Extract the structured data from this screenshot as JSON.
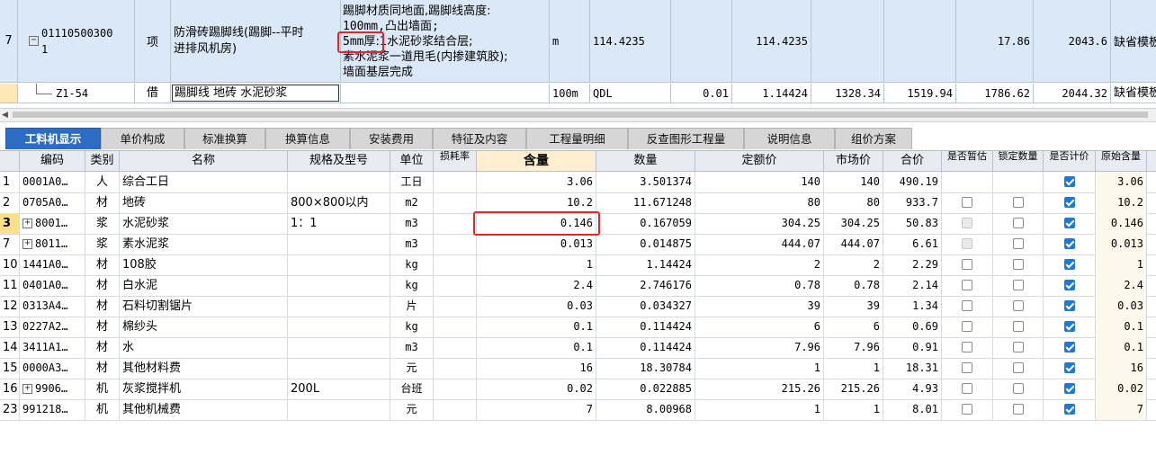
{
  "top": {
    "row1": {
      "index": "7",
      "toggle": "−",
      "code_l1": "01110500300",
      "code_l2": "1",
      "type": "项",
      "name_l1": "防滑砖踢脚线(踢脚--平时",
      "name_l2": "进排风机房)",
      "desc_l1": "踢脚材质同地面,踢脚线高度:",
      "desc_l2": "100mm,凸出墙面;",
      "desc_l3a": "5mm厚",
      "desc_l3b": ":1水泥砂浆结合层;",
      "desc_l4": "素水泥浆一道甩毛(内掺建筑胶);",
      "desc_l5": "墙面基层完成",
      "unit": "m",
      "expr": "114.4235",
      "qty": "114.4235",
      "price": "17.86",
      "total": "2043.6",
      "tail": "缺省模板"
    },
    "row2": {
      "code": "Z1-54",
      "type": "借",
      "name": "踢脚线 地砖 水泥砂浆",
      "unit": "100m",
      "expr": "QDL",
      "factor": "0.01",
      "qty": "1.14424",
      "v1": "1328.34",
      "v2": "1519.94",
      "v3": "1786.62",
      "v4": "2044.32",
      "tail": "缺省模板"
    }
  },
  "tabs": [
    {
      "label": "工料机显示",
      "active": true
    },
    {
      "label": "单价构成"
    },
    {
      "label": "标准换算"
    },
    {
      "label": "换算信息"
    },
    {
      "label": "安装费用"
    },
    {
      "label": "特征及内容"
    },
    {
      "label": "工程量明细"
    },
    {
      "label": "反查图形工程量"
    },
    {
      "label": "说明信息"
    },
    {
      "label": "组价方案"
    }
  ],
  "grid": {
    "headers": {
      "code": "编码",
      "kind": "类别",
      "name": "名称",
      "spec": "规格及型号",
      "unit": "单位",
      "loss": "损耗率",
      "content": "含量",
      "qty": "数量",
      "quota": "定额价",
      "market": "市场价",
      "total": "合价",
      "temp": "是否暂估",
      "lock": "锁定数量",
      "calc": "是否计价",
      "orig": "原始含量"
    },
    "rows": [
      {
        "idx": "1",
        "plus": false,
        "code": "0001A0…",
        "kind": "人",
        "name": "综合工日",
        "spec": "",
        "unit": "工日",
        "content": "3.06",
        "qty": "3.501374",
        "quota": "140",
        "market": "140",
        "total": "490.19",
        "temp": "none",
        "lock": "none",
        "calc": "on",
        "orig": "3.06"
      },
      {
        "idx": "2",
        "plus": false,
        "code": "0705A0…",
        "kind": "材",
        "name": "地砖",
        "spec": "800×800以内",
        "unit": "m2",
        "content": "10.2",
        "qty": "11.671248",
        "quota": "80",
        "market": "80",
        "total": "933.7",
        "temp": "off",
        "lock": "off",
        "calc": "on",
        "orig": "10.2"
      },
      {
        "idx": "3",
        "plus": true,
        "code": "8001…",
        "kind": "浆",
        "name": "水泥砂浆",
        "spec": "1：1",
        "unit": "m3",
        "content": "0.146",
        "qty": "0.167059",
        "quota": "304.25",
        "market": "304.25",
        "total": "50.83",
        "temp": "dis",
        "lock": "off",
        "calc": "on",
        "orig": "0.146"
      },
      {
        "idx": "7",
        "plus": true,
        "code": "8011…",
        "kind": "浆",
        "name": "素水泥浆",
        "spec": "",
        "unit": "m3",
        "content": "0.013",
        "qty": "0.014875",
        "quota": "444.07",
        "market": "444.07",
        "total": "6.61",
        "temp": "dis",
        "lock": "off",
        "calc": "on",
        "orig": "0.013"
      },
      {
        "idx": "10",
        "plus": false,
        "code": "1441A0…",
        "kind": "材",
        "name": "108胶",
        "spec": "",
        "unit": "kg",
        "content": "1",
        "qty": "1.14424",
        "quota": "2",
        "market": "2",
        "total": "2.29",
        "temp": "off",
        "lock": "off",
        "calc": "on",
        "orig": "1"
      },
      {
        "idx": "11",
        "plus": false,
        "code": "0401A0…",
        "kind": "材",
        "name": "白水泥",
        "spec": "",
        "unit": "kg",
        "content": "2.4",
        "qty": "2.746176",
        "quota": "0.78",
        "market": "0.78",
        "total": "2.14",
        "temp": "off",
        "lock": "off",
        "calc": "on",
        "orig": "2.4"
      },
      {
        "idx": "12",
        "plus": false,
        "code": "0313A4…",
        "kind": "材",
        "name": "石料切割锯片",
        "spec": "",
        "unit": "片",
        "content": "0.03",
        "qty": "0.034327",
        "quota": "39",
        "market": "39",
        "total": "1.34",
        "temp": "off",
        "lock": "off",
        "calc": "on",
        "orig": "0.03"
      },
      {
        "idx": "13",
        "plus": false,
        "code": "0227A2…",
        "kind": "材",
        "name": "棉纱头",
        "spec": "",
        "unit": "kg",
        "content": "0.1",
        "qty": "0.114424",
        "quota": "6",
        "market": "6",
        "total": "0.69",
        "temp": "off",
        "lock": "off",
        "calc": "on",
        "orig": "0.1"
      },
      {
        "idx": "14",
        "plus": false,
        "code": "3411A1…",
        "kind": "材",
        "name": "水",
        "spec": "",
        "unit": "m3",
        "content": "0.1",
        "qty": "0.114424",
        "quota": "7.96",
        "market": "7.96",
        "total": "0.91",
        "temp": "off",
        "lock": "off",
        "calc": "on",
        "orig": "0.1"
      },
      {
        "idx": "15",
        "plus": false,
        "code": "0000A3…",
        "kind": "材",
        "name": "其他材料费",
        "spec": "",
        "unit": "元",
        "content": "16",
        "qty": "18.30784",
        "quota": "1",
        "market": "1",
        "total": "18.31",
        "temp": "off",
        "lock": "off",
        "calc": "on",
        "orig": "16"
      },
      {
        "idx": "16",
        "plus": true,
        "code": "9906…",
        "kind": "机",
        "name": "灰浆搅拌机",
        "spec": "200L",
        "unit": "台班",
        "content": "0.02",
        "qty": "0.022885",
        "quota": "215.26",
        "market": "215.26",
        "total": "4.93",
        "temp": "off",
        "lock": "off",
        "calc": "on",
        "orig": "0.02"
      },
      {
        "idx": "23",
        "plus": false,
        "code": "991218…",
        "kind": "机",
        "name": "其他机械费",
        "spec": "",
        "unit": "元",
        "content": "7",
        "qty": "8.00968",
        "quota": "1",
        "market": "1",
        "total": "8.01",
        "temp": "off",
        "lock": "off",
        "calc": "on",
        "orig": "7"
      }
    ]
  }
}
